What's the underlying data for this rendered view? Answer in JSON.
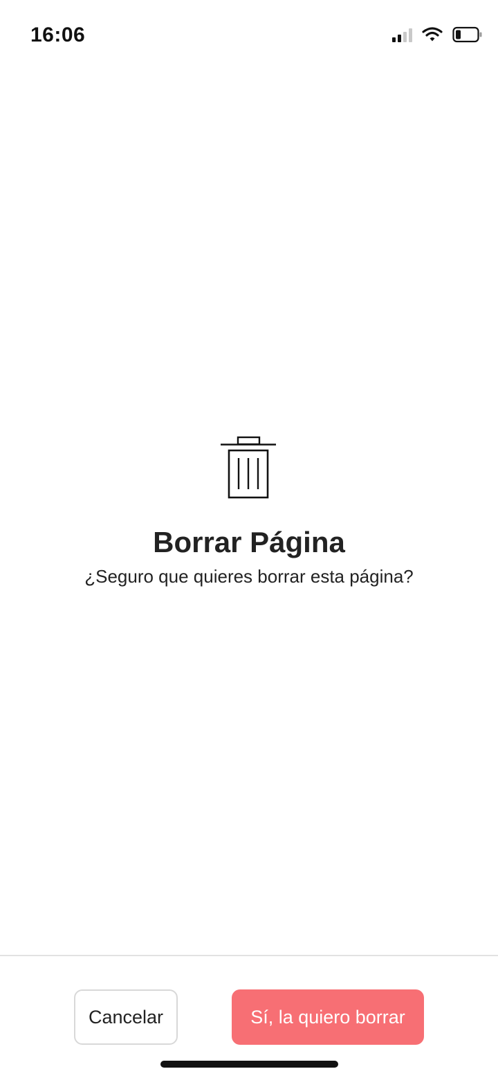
{
  "status_bar": {
    "time": "16:06",
    "signal_icon": "cellular-signal-icon",
    "wifi_icon": "wifi-icon",
    "battery_icon": "battery-icon"
  },
  "dialog": {
    "icon": "trash-icon",
    "title": "Borrar Página",
    "message": "¿Seguro que quieres borrar esta página?"
  },
  "actions": {
    "cancel_label": "Cancelar",
    "confirm_label": "Sí, la quiero borrar"
  },
  "colors": {
    "confirm_button": "#f76f74",
    "text": "#222222",
    "divider": "#e2e2e2"
  }
}
